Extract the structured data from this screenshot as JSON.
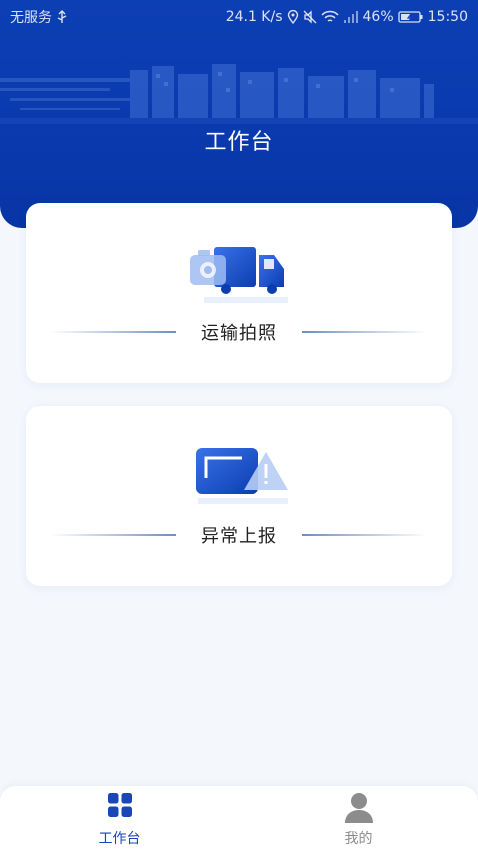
{
  "status_bar": {
    "carrier": "无服务",
    "speed": "24.1 K/s",
    "battery": "46%",
    "time": "15:50",
    "icons": [
      "usb-icon",
      "location-icon",
      "mute-icon",
      "wifi-icon",
      "signal-icon",
      "battery-icon"
    ]
  },
  "header": {
    "title": "工作台",
    "bg_color": "#0d3fb4"
  },
  "cards": [
    {
      "label": "运输拍照",
      "icon": "truck-camera-icon"
    },
    {
      "label": "异常上报",
      "icon": "warning-card-icon"
    }
  ],
  "tabbar": {
    "tabs": [
      {
        "label": "工作台",
        "icon": "grid-icon",
        "active": true,
        "color": "#1a46b8"
      },
      {
        "label": "我的",
        "icon": "person-icon",
        "active": false,
        "color": "#8c8c8c"
      }
    ]
  }
}
